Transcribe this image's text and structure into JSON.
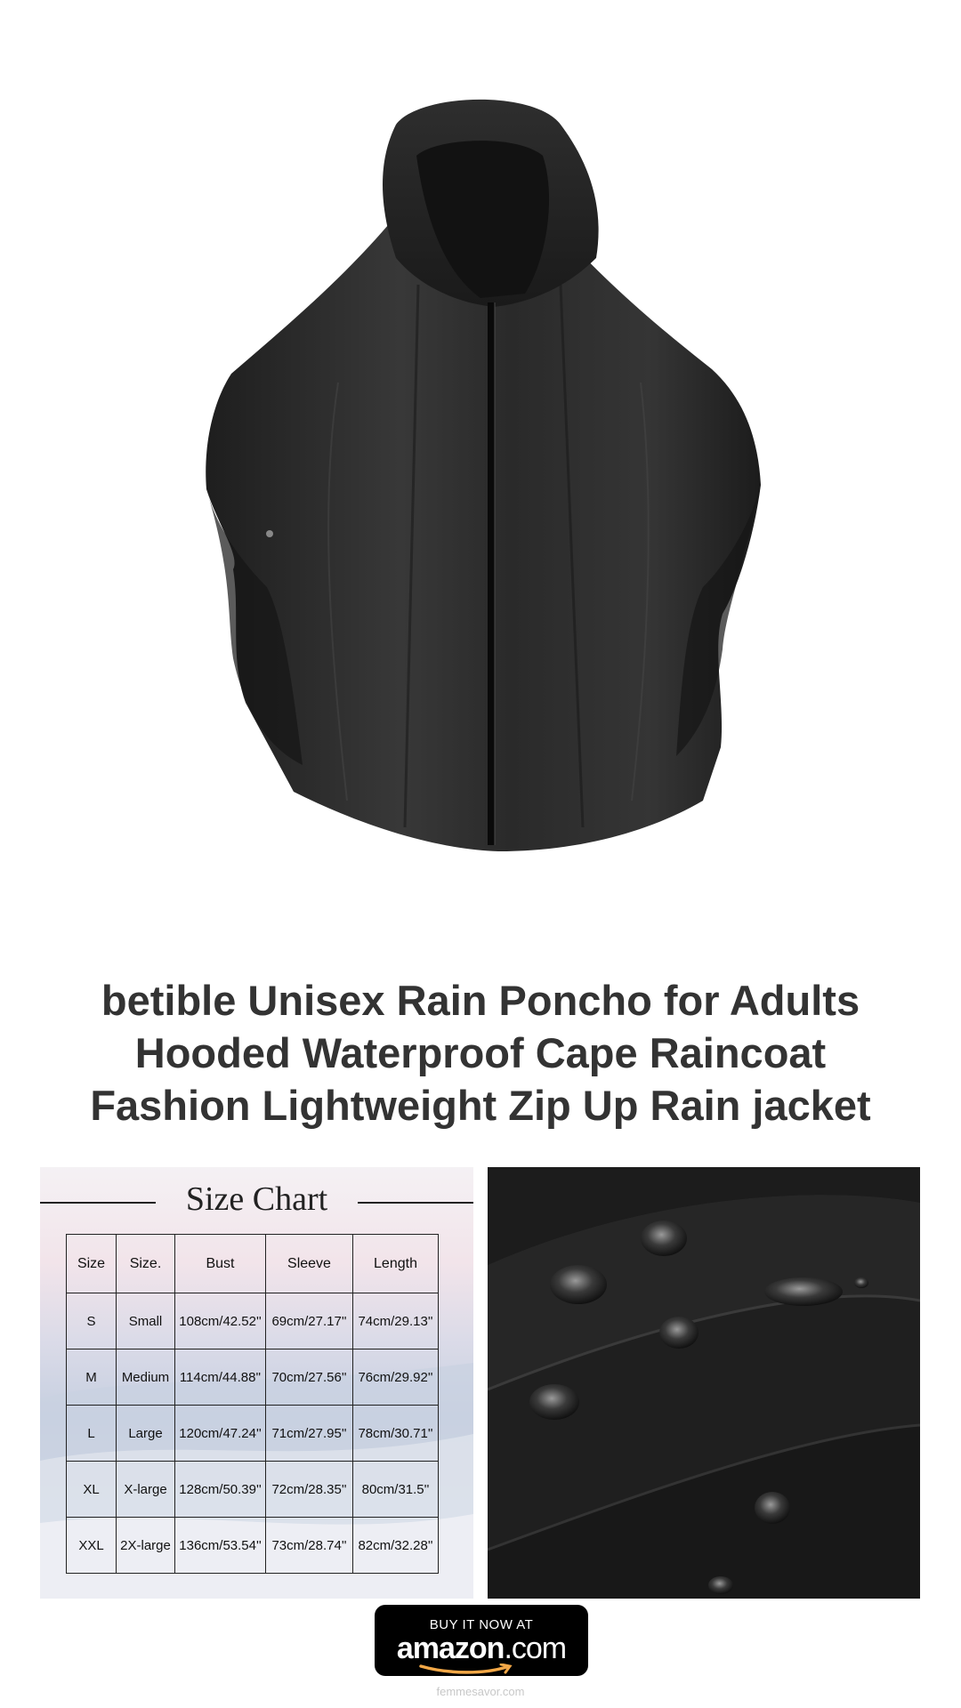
{
  "product": {
    "title_lines": [
      "betible Unisex Rain Poncho for Adults",
      "Hooded Waterproof Cape Raincoat",
      "Fashion Lightweight Zip Up Rain jacket"
    ],
    "color": "#2b2b2b"
  },
  "size_chart": {
    "heading": "Size Chart",
    "headers": [
      "Size",
      "Size.",
      "Bust",
      "Sleeve",
      "Length"
    ],
    "rows": [
      [
        "S",
        "Small",
        "108cm/42.52''",
        "69cm/27.17''",
        "74cm/29.13''"
      ],
      [
        "M",
        "Medium",
        "114cm/44.88''",
        "70cm/27.56''",
        "76cm/29.92''"
      ],
      [
        "L",
        "Large",
        "120cm/47.24''",
        "71cm/27.95''",
        "78cm/30.71''"
      ],
      [
        "XL",
        "X-large",
        "128cm/50.39''",
        "72cm/28.35''",
        "80cm/31.5''"
      ],
      [
        "XXL",
        "2X-large",
        "136cm/53.54''",
        "73cm/28.74''",
        "82cm/32.28''"
      ]
    ]
  },
  "buy_button": {
    "top_text": "BUY IT NOW AT",
    "brand": "amazon",
    "brand_suffix": ".com",
    "smile_color": "#f3a847"
  },
  "footer": {
    "site": "femmesavor.com"
  }
}
